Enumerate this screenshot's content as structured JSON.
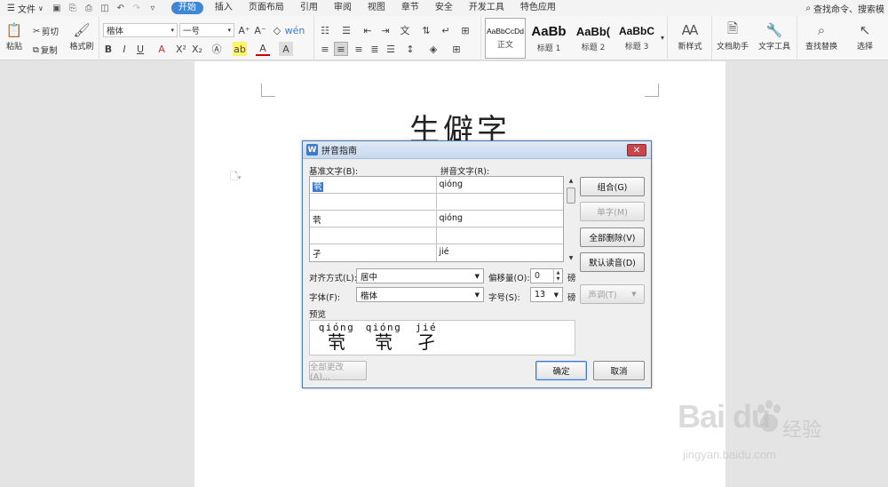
{
  "menubar": {
    "file_label": "文件",
    "tabs": [
      {
        "label": "开始",
        "active": true
      },
      {
        "label": "插入"
      },
      {
        "label": "页面布局"
      },
      {
        "label": "引用"
      },
      {
        "label": "审阅"
      },
      {
        "label": "视图"
      },
      {
        "label": "章节"
      },
      {
        "label": "安全"
      },
      {
        "label": "开发工具"
      },
      {
        "label": "特色应用"
      }
    ],
    "search_label": "查找命令、搜索模"
  },
  "ribbon": {
    "paste_label": "粘贴",
    "cut_label": "剪切",
    "copy_label": "复制",
    "format_painter_label": "格式刷",
    "font_name": "楷体",
    "font_size": "一号",
    "styles": [
      {
        "sample": "AaBbCcDd",
        "label": "正文"
      },
      {
        "sample": "AaBb",
        "label": "标题 1"
      },
      {
        "sample": "AaBb(",
        "label": "标题 2"
      },
      {
        "sample": "AaBbC",
        "label": "标题 3"
      }
    ],
    "new_style_label": "新样式",
    "doc_helper_label": "文档助手",
    "text_tools_label": "文字工具",
    "find_replace_label": "查找替换",
    "select_label": "选择"
  },
  "document": {
    "title": "生僻字"
  },
  "dialog": {
    "title": "拼音指南",
    "base_text_label": "基准文字(B):",
    "ruby_text_label": "拼音文字(R):",
    "rows": [
      {
        "base": "茕",
        "ruby": "qióng",
        "selected": true
      },
      {
        "base": "",
        "ruby": ""
      },
      {
        "base": "茕",
        "ruby": "qióng"
      },
      {
        "base": "",
        "ruby": ""
      },
      {
        "base": "孑",
        "ruby": "jié"
      }
    ],
    "buttons": {
      "group": "组合(G)",
      "single": "单字(M)",
      "clear_all": "全部删除(V)",
      "default_reading": "默认读音(D)",
      "tone": "声调(T)",
      "change_all": "全部更改 (A)...",
      "ok": "确定",
      "cancel": "取消"
    },
    "alignment_label": "对齐方式(L):",
    "alignment_value": "居中",
    "offset_label": "偏移量(O):",
    "offset_value": "0",
    "offset_unit": "磅",
    "font_label": "字体(F):",
    "font_value": "楷体",
    "size_label": "字号(S):",
    "size_value": "13",
    "size_unit": "磅",
    "preview_label": "预览",
    "preview": [
      {
        "pinyin": "qióng",
        "char": "茕"
      },
      {
        "pinyin": "qióng",
        "char": "茕"
      },
      {
        "pinyin": "jié",
        "char": "孑"
      }
    ]
  },
  "watermark": {
    "logo": "Bai du",
    "cn": "经验",
    "url": "jingyan.baidu.com"
  }
}
